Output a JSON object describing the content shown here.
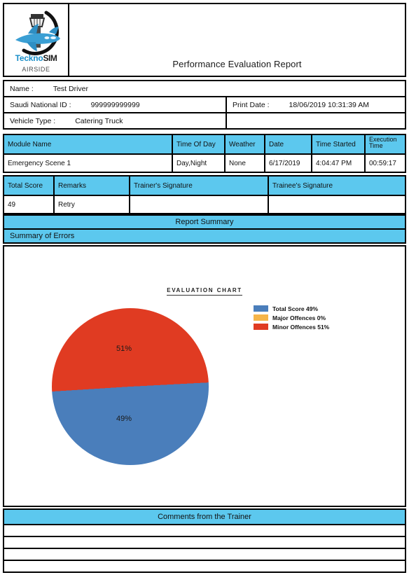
{
  "header": {
    "title": "Performance Evaluation Report",
    "logo": {
      "brand": "Teckno",
      "brand_suffix": "SIM",
      "subtitle": "AIRSIDE",
      "icon": "airplane-control-tower-logo"
    }
  },
  "info": {
    "name_label": "Name :",
    "name_value": "Test Driver",
    "national_id_label": "Saudi National ID :",
    "national_id_value": "999999999999",
    "print_date_label": "Print Date :",
    "print_date_value": "18/06/2019 10:31:39 AM",
    "vehicle_type_label": "Vehicle Type :",
    "vehicle_type_value": "Catering Truck"
  },
  "module_table": {
    "headers": [
      "Module Name",
      "Time Of Day",
      "Weather",
      "Date",
      "Time Started",
      "Execution Time"
    ],
    "rows": [
      [
        "Emergency Scene 1",
        "Day,Night",
        "None",
        "6/17/2019",
        "4:04:47 PM",
        "00:59:17"
      ]
    ]
  },
  "score_table": {
    "headers": [
      "Total Score",
      "Remarks",
      "Trainer's Signature",
      "Trainee's Signature"
    ],
    "rows": [
      [
        "49",
        "Retry",
        "",
        ""
      ]
    ]
  },
  "banners": {
    "report_summary": "Report Summary",
    "summary_of_errors": "Summary of Errors",
    "comments_from_trainer": "Comments from the Trainer"
  },
  "comment_rows": [
    "",
    "",
    "",
    ""
  ],
  "colors": {
    "header_cyan": "#5cc8ee",
    "total_score": "#4a7ebb",
    "major_offences": "#f5b54a",
    "minor_offences": "#e03b22",
    "border": "#000000"
  },
  "chart_data": {
    "type": "pie",
    "title": "Evaluation Chart",
    "categories": [
      "Total Score",
      "Major Offences",
      "Minor Offences"
    ],
    "values": [
      49,
      0,
      51
    ],
    "unit": "%",
    "slice_labels": [
      "49%",
      "",
      "51%"
    ],
    "colors": [
      "#4a7ebb",
      "#f5b54a",
      "#e03b22"
    ],
    "legend": [
      {
        "label": "Total Score 49%",
        "color": "#4a7ebb"
      },
      {
        "label": "Major Offences 0%",
        "color": "#f5b54a"
      },
      {
        "label": "Minor Offences 51%",
        "color": "#e03b22"
      }
    ],
    "legend_position": "right",
    "grid": false,
    "start_angle_deg": 3
  }
}
